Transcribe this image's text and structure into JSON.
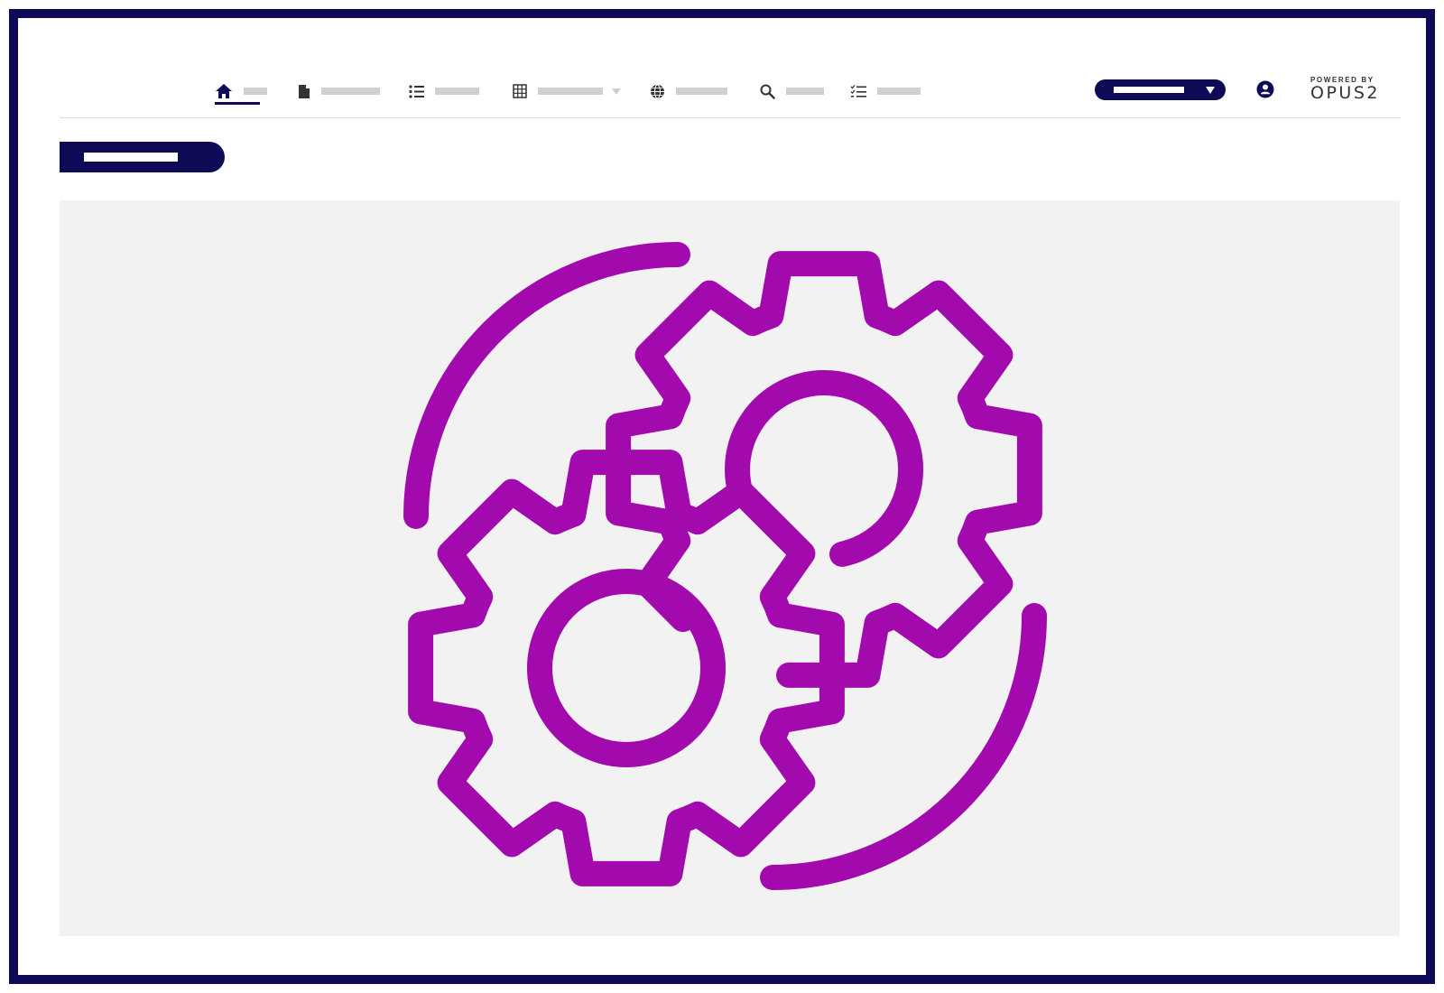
{
  "app": {
    "brand": {
      "powered_by": "POWERED BY",
      "name": "OPUS2"
    }
  },
  "colors": {
    "frame": "#0e0a55",
    "accent": "#0e0a55",
    "illustration": "#a20aae",
    "placeholder": "#cfcfcf",
    "panel": "#f2f2f2"
  },
  "nav": {
    "items": [
      {
        "icon": "home-icon",
        "active": true
      },
      {
        "icon": "document-icon"
      },
      {
        "icon": "list-icon"
      },
      {
        "icon": "grid-icon",
        "has_dropdown": true
      },
      {
        "icon": "globe-icon"
      },
      {
        "icon": "search-icon"
      },
      {
        "icon": "checklist-icon"
      }
    ]
  },
  "header": {
    "dropdown_icon": "chevron-down-icon",
    "avatar_icon": "user-icon"
  },
  "main": {
    "illustration": "gears-icon"
  }
}
